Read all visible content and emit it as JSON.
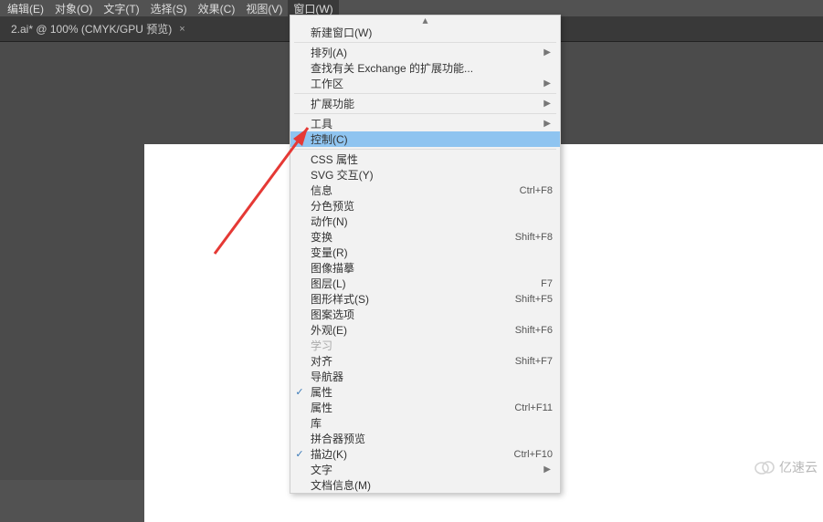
{
  "menubar": {
    "items": [
      {
        "label": "编辑(E)"
      },
      {
        "label": "对象(O)"
      },
      {
        "label": "文字(T)"
      },
      {
        "label": "选择(S)"
      },
      {
        "label": "效果(C)"
      },
      {
        "label": "视图(V)"
      },
      {
        "label": "窗口(W)"
      }
    ],
    "active_index": 6
  },
  "document_tab": {
    "title": "2.ai* @ 100% (CMYK/GPU 预览)",
    "close": "×"
  },
  "dropdown": {
    "highlight_label": "控制(C)",
    "groups": [
      [
        {
          "label": "新建窗口(W)"
        }
      ],
      [
        {
          "label": "排列(A)",
          "submenu": true
        },
        {
          "label": "查找有关 Exchange 的扩展功能..."
        },
        {
          "label": "工作区",
          "submenu": true
        }
      ],
      [
        {
          "label": "扩展功能",
          "submenu": true
        }
      ],
      [
        {
          "label": "工具",
          "submenu": true
        },
        {
          "label": "控制(C)",
          "highlight": true
        }
      ],
      [
        {
          "label": "CSS 属性"
        },
        {
          "label": "SVG 交互(Y)"
        },
        {
          "label": "信息",
          "shortcut": "Ctrl+F8"
        },
        {
          "label": "分色预览"
        },
        {
          "label": "动作(N)"
        },
        {
          "label": "变换",
          "shortcut": "Shift+F8"
        },
        {
          "label": "变量(R)"
        },
        {
          "label": "图像描摹"
        },
        {
          "label": "图层(L)",
          "shortcut": "F7"
        },
        {
          "label": "图形样式(S)",
          "shortcut": "Shift+F5"
        },
        {
          "label": "图案选项"
        },
        {
          "label": "外观(E)",
          "shortcut": "Shift+F6"
        },
        {
          "label": "学习",
          "disabled": true
        },
        {
          "label": "对齐",
          "shortcut": "Shift+F7"
        },
        {
          "label": "导航器"
        },
        {
          "label": "属性",
          "checked": true
        },
        {
          "label": "属性",
          "shortcut": "Ctrl+F11"
        },
        {
          "label": "库"
        },
        {
          "label": "拼合器预览"
        },
        {
          "label": "描边(K)",
          "shortcut": "Ctrl+F10",
          "checked": true
        },
        {
          "label": "文字",
          "submenu": true
        },
        {
          "label": "文档信息(M)"
        }
      ]
    ]
  },
  "watermark": {
    "text": "亿速云"
  }
}
